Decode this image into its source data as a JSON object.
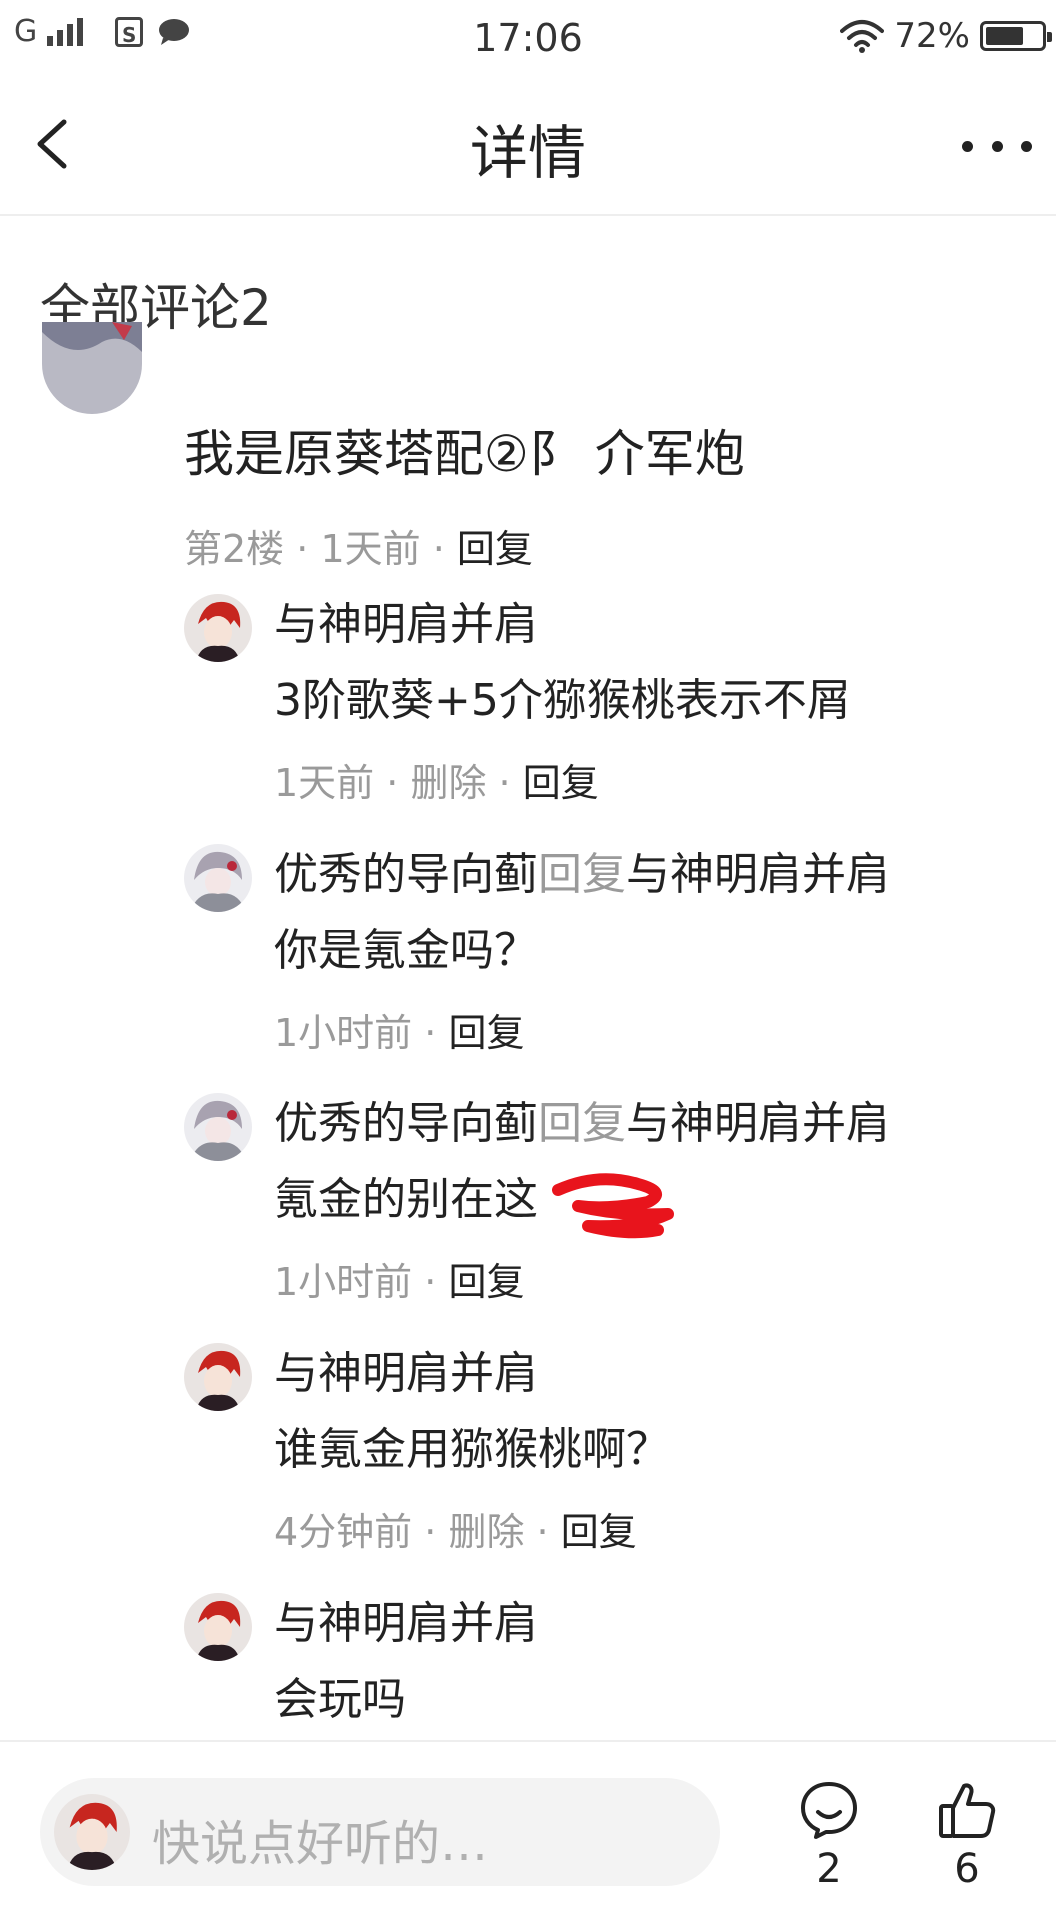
{
  "status_bar": {
    "carrier": "G",
    "time": "17:06",
    "battery_percent": "72%",
    "battery_level": 0.72
  },
  "nav": {
    "title": "详情"
  },
  "comments": {
    "section_title": "全部评论2",
    "main_comment": {
      "text": "我是原葵塔配②阝 介军炮",
      "floor": "第2楼",
      "time": "1天前",
      "reply_label": "回复",
      "sep": " · "
    },
    "replies": [
      {
        "author": "与神明肩并肩",
        "reply_word": "",
        "target": "",
        "text": "3阶歌葵+5介猕猴桃表示不屑",
        "time": "1天前",
        "delete_label": "删除",
        "reply_label": "回复"
      },
      {
        "author": "优秀的导向蓟",
        "reply_word": "回复",
        "target": "与神明肩并肩",
        "text": "你是氪金吗？",
        "time": "1小时前",
        "delete_label": "",
        "reply_label": "回复"
      },
      {
        "author": "优秀的导向蓟",
        "reply_word": "回复",
        "target": "与神明肩并肩",
        "text": "氪金的别在这",
        "time": "1小时前",
        "delete_label": "",
        "reply_label": "回复"
      },
      {
        "author": "与神明肩并肩",
        "reply_word": "",
        "target": "",
        "text": "谁氪金用猕猴桃啊？",
        "time": "4分钟前",
        "delete_label": "删除",
        "reply_label": "回复"
      },
      {
        "author": "与神明肩并肩",
        "reply_word": "",
        "target": "",
        "text": "会玩吗",
        "time": "",
        "delete_label": "",
        "reply_label": ""
      }
    ]
  },
  "bottom_bar": {
    "input_placeholder": "快说点好听的…",
    "comment_count": "2",
    "like_count": "6"
  },
  "colors": {
    "text_primary": "#222222",
    "text_secondary": "#9a9a9a",
    "redaction": "#e8141c",
    "input_bg": "#f3f3f3"
  },
  "icons": {
    "back": "chevron-left-icon",
    "more": "more-dots-icon",
    "comment": "comment-bubble-icon",
    "like": "thumbs-up-icon"
  }
}
